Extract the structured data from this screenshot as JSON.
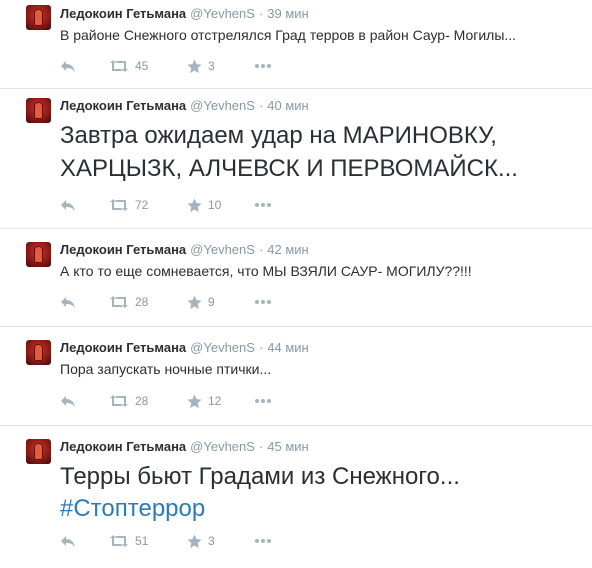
{
  "tweets": [
    {
      "name": "Ледокоин Гетьмана",
      "handle": "@YevhenS",
      "time": "39 мин",
      "text": "В районе Снежного отстрелялся Град терров в район Саур- Могилы...",
      "retweets": "45",
      "favorites": "3"
    },
    {
      "name": "Ледокоин Гетьмана",
      "handle": "@YevhenS",
      "time": "40 мин",
      "text_lines": [
        "Завтра ожидаем удар на МАРИНОВКУ,",
        "ХАРЦЫЗК, АЛЧЕВСК И ПЕРВОМАЙСК..."
      ],
      "retweets": "72",
      "favorites": "10"
    },
    {
      "name": "Ледокоин Гетьмана",
      "handle": "@YevhenS",
      "time": "42 мин",
      "text": "А кто то еще сомневается, что МЫ ВЗЯЛИ САУР- МОГИЛУ??!!!",
      "retweets": "28",
      "favorites": "9"
    },
    {
      "name": "Ледокоин Гетьмана",
      "handle": "@YevhenS",
      "time": "44 мин",
      "text": "Пора запускать ночные птички...",
      "retweets": "28",
      "favorites": "12"
    },
    {
      "name": "Ледокоин Гетьмана",
      "handle": "@YevhenS",
      "time": "45 мин",
      "text": "Терры бьют Градами из Снежного...",
      "hashtag": "#Стоптеррор",
      "retweets": "51",
      "favorites": "3"
    }
  ],
  "icons": {
    "reply": "reply-icon",
    "retweet": "retweet-icon",
    "favorite": "star-icon",
    "more": "more-icon"
  },
  "colors": {
    "link": "#2b7bb9",
    "muted": "#8899a6",
    "text": "#292f33",
    "avatar": "#c62a24"
  }
}
